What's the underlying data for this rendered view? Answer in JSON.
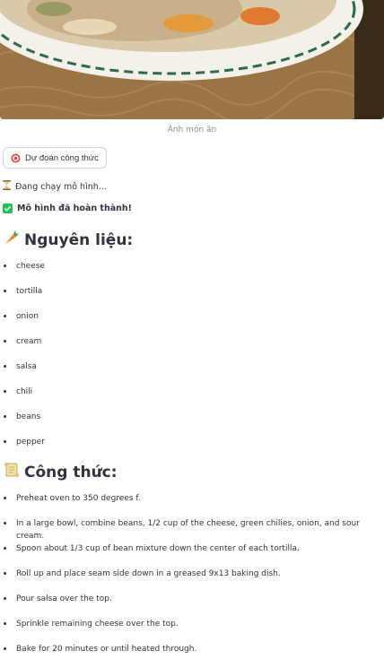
{
  "image": {
    "caption": "Ảnh món ăn"
  },
  "predict_button": {
    "label": "Dự đoán công thức",
    "icon": "target-icon"
  },
  "status": {
    "running": "Đang chạy mô hình...",
    "running_icon": "hourglass-icon",
    "done": "Mô hình đã hoàn thành!",
    "done_icon": "check-icon"
  },
  "ingredients": {
    "title": "Nguyên liệu:",
    "icon": "carrot-icon",
    "items": [
      "cheese",
      "tortilla",
      "onion",
      "cream",
      "salsa",
      "chili",
      "beans",
      "pepper"
    ]
  },
  "recipe": {
    "title": "Công thức:",
    "icon": "scroll-icon",
    "steps": [
      "Preheat oven to 350 degrees f.",
      "In a large bowl, combine beans, 1/2 cup of the cheese, green chilies, onion, and sour cream.",
      "Spoon about 1/3 cup of bean mixture down the center of each tortilla.",
      "Roll up and place seam side down in a greased 9x13 baking dish.",
      "Pour salsa over the top.",
      "Sprinkle remaining cheese over the top.",
      "Bake for 20 minutes or until heated through."
    ]
  },
  "colors": {
    "text": "#31333f",
    "success": "#21c354",
    "muted": "#8b8d97",
    "border": "#d3d5db"
  }
}
